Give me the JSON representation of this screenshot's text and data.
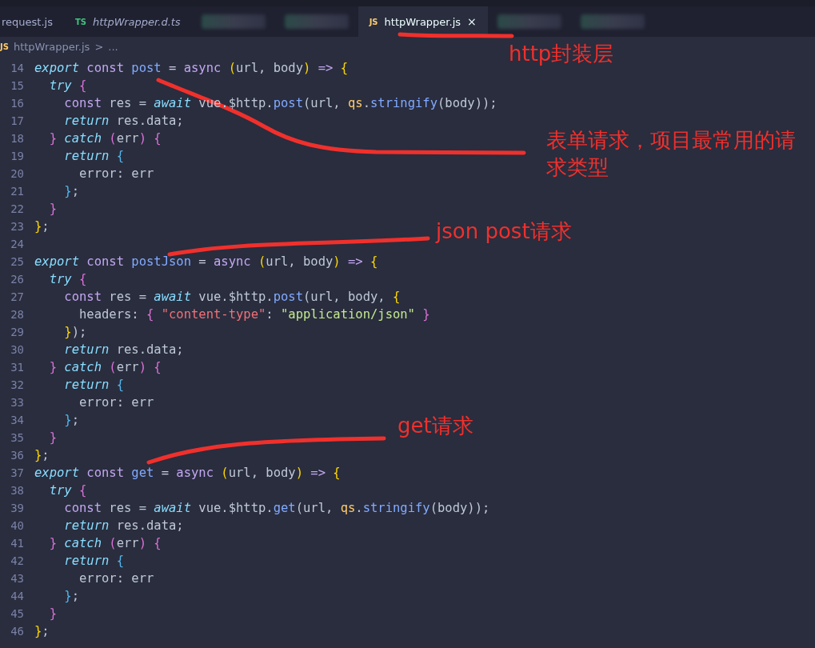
{
  "tabs": [
    {
      "kind": "file",
      "label": "request.js",
      "selected": false,
      "italic": false
    },
    {
      "kind": "file",
      "badge": "TS",
      "label": "httpWrapper.d.ts",
      "selected": false,
      "italic": true
    },
    {
      "kind": "blurred"
    },
    {
      "kind": "blurred"
    },
    {
      "kind": "file",
      "badge": "JS",
      "label": "httpWrapper.js",
      "selected": true,
      "italic": false,
      "close": "×"
    },
    {
      "kind": "blurred"
    },
    {
      "kind": "blurred"
    }
  ],
  "breadcrumb": {
    "badge": "JS",
    "file": "httpWrapper.js",
    "separator": ">",
    "rest": "..."
  },
  "lines": [
    {
      "number": "14",
      "tokens": [
        {
          "text": "export",
          "kind": "kw"
        },
        {
          "text": " const",
          "kind": "store"
        },
        {
          "text": " post",
          "kind": "fn"
        },
        {
          "text": " = ",
          "kind": "op"
        },
        {
          "text": "async",
          "kind": "store"
        },
        {
          "text": " (",
          "kind": "p1"
        },
        {
          "text": "url, body",
          "kind": "plain"
        },
        {
          "text": ")",
          "kind": "p1"
        },
        {
          "text": " =>",
          "kind": "store"
        },
        {
          "text": " {",
          "kind": "p1"
        }
      ]
    },
    {
      "number": "15",
      "tokens": [
        {
          "text": "  try",
          "kind": "kw"
        },
        {
          "text": " {",
          "kind": "p2"
        }
      ]
    },
    {
      "number": "16",
      "tokens": [
        {
          "text": "    const",
          "kind": "store"
        },
        {
          "text": " res = ",
          "kind": "plain"
        },
        {
          "text": "await",
          "kind": "kw"
        },
        {
          "text": " vue.$http.",
          "kind": "plain"
        },
        {
          "text": "post",
          "kind": "fn"
        },
        {
          "text": "(url, ",
          "kind": "plain"
        },
        {
          "text": "qs",
          "kind": "obj"
        },
        {
          "text": ".",
          "kind": "plain"
        },
        {
          "text": "stringify",
          "kind": "fn"
        },
        {
          "text": "(body));",
          "kind": "plain"
        }
      ]
    },
    {
      "number": "17",
      "tokens": [
        {
          "text": "    return",
          "kind": "kw"
        },
        {
          "text": " res.data;",
          "kind": "plain"
        }
      ]
    },
    {
      "number": "18",
      "tokens": [
        {
          "text": "  }",
          "kind": "p2"
        },
        {
          "text": " catch",
          "kind": "kw"
        },
        {
          "text": " (",
          "kind": "p2"
        },
        {
          "text": "err",
          "kind": "plain"
        },
        {
          "text": ")",
          "kind": "p2"
        },
        {
          "text": " {",
          "kind": "p2"
        }
      ]
    },
    {
      "number": "19",
      "tokens": [
        {
          "text": "    return",
          "kind": "kw"
        },
        {
          "text": " {",
          "kind": "p3"
        }
      ]
    },
    {
      "number": "20",
      "tokens": [
        {
          "text": "      error: err",
          "kind": "plain"
        }
      ]
    },
    {
      "number": "21",
      "tokens": [
        {
          "text": "    }",
          "kind": "p3"
        },
        {
          "text": ";",
          "kind": "plain"
        }
      ]
    },
    {
      "number": "22",
      "tokens": [
        {
          "text": "  }",
          "kind": "p2"
        }
      ]
    },
    {
      "number": "23",
      "tokens": [
        {
          "text": "}",
          "kind": "p1"
        },
        {
          "text": ";",
          "kind": "plain"
        }
      ]
    },
    {
      "number": "24"
    },
    {
      "number": "25",
      "tokens": [
        {
          "text": "export",
          "kind": "kw"
        },
        {
          "text": " const",
          "kind": "store"
        },
        {
          "text": " postJson",
          "kind": "fn"
        },
        {
          "text": " = ",
          "kind": "op"
        },
        {
          "text": "async",
          "kind": "store"
        },
        {
          "text": " (",
          "kind": "p1"
        },
        {
          "text": "url, body",
          "kind": "plain"
        },
        {
          "text": ")",
          "kind": "p1"
        },
        {
          "text": " =>",
          "kind": "store"
        },
        {
          "text": " {",
          "kind": "p1"
        }
      ]
    },
    {
      "number": "26",
      "tokens": [
        {
          "text": "  try",
          "kind": "kw"
        },
        {
          "text": " {",
          "kind": "p2"
        }
      ]
    },
    {
      "number": "27",
      "tokens": [
        {
          "text": "    const",
          "kind": "store"
        },
        {
          "text": " res = ",
          "kind": "plain"
        },
        {
          "text": "await",
          "kind": "kw"
        },
        {
          "text": " vue.$http.",
          "kind": "plain"
        },
        {
          "text": "post",
          "kind": "fn"
        },
        {
          "text": "(url, body, ",
          "kind": "plain"
        },
        {
          "text": "{",
          "kind": "p1"
        }
      ]
    },
    {
      "number": "28",
      "tokens": [
        {
          "text": "      headers: ",
          "kind": "plain"
        },
        {
          "text": "{",
          "kind": "p2"
        },
        {
          "text": " \"content-type\"",
          "kind": "str1"
        },
        {
          "text": ": ",
          "kind": "plain"
        },
        {
          "text": "\"application/json\"",
          "kind": "str2"
        },
        {
          "text": " }",
          "kind": "p2"
        }
      ]
    },
    {
      "number": "29",
      "tokens": [
        {
          "text": "    }",
          "kind": "p1"
        },
        {
          "text": ");",
          "kind": "plain"
        }
      ]
    },
    {
      "number": "30",
      "tokens": [
        {
          "text": "    return",
          "kind": "kw"
        },
        {
          "text": " res.data;",
          "kind": "plain"
        }
      ]
    },
    {
      "number": "31",
      "tokens": [
        {
          "text": "  }",
          "kind": "p2"
        },
        {
          "text": " catch",
          "kind": "kw"
        },
        {
          "text": " (",
          "kind": "p2"
        },
        {
          "text": "err",
          "kind": "plain"
        },
        {
          "text": ")",
          "kind": "p2"
        },
        {
          "text": " {",
          "kind": "p2"
        }
      ]
    },
    {
      "number": "32",
      "tokens": [
        {
          "text": "    return",
          "kind": "kw"
        },
        {
          "text": " {",
          "kind": "p3"
        }
      ]
    },
    {
      "number": "33",
      "tokens": [
        {
          "text": "      error: err",
          "kind": "plain"
        }
      ]
    },
    {
      "number": "34",
      "tokens": [
        {
          "text": "    }",
          "kind": "p3"
        },
        {
          "text": ";",
          "kind": "plain"
        }
      ]
    },
    {
      "number": "35",
      "tokens": [
        {
          "text": "  }",
          "kind": "p2"
        }
      ]
    },
    {
      "number": "36",
      "tokens": [
        {
          "text": "}",
          "kind": "p1"
        },
        {
          "text": ";",
          "kind": "plain"
        }
      ]
    },
    {
      "number": "37",
      "tokens": [
        {
          "text": "export",
          "kind": "kw"
        },
        {
          "text": " const",
          "kind": "store"
        },
        {
          "text": " get",
          "kind": "fn"
        },
        {
          "text": " = ",
          "kind": "op"
        },
        {
          "text": "async",
          "kind": "store"
        },
        {
          "text": " (",
          "kind": "p1"
        },
        {
          "text": "url, body",
          "kind": "plain"
        },
        {
          "text": ")",
          "kind": "p1"
        },
        {
          "text": " =>",
          "kind": "store"
        },
        {
          "text": " {",
          "kind": "p1"
        }
      ]
    },
    {
      "number": "38",
      "tokens": [
        {
          "text": "  try",
          "kind": "kw"
        },
        {
          "text": " {",
          "kind": "p2"
        }
      ]
    },
    {
      "number": "39",
      "tokens": [
        {
          "text": "    const",
          "kind": "store"
        },
        {
          "text": " res = ",
          "kind": "plain"
        },
        {
          "text": "await",
          "kind": "kw"
        },
        {
          "text": " vue.$http.",
          "kind": "plain"
        },
        {
          "text": "get",
          "kind": "fn"
        },
        {
          "text": "(url, ",
          "kind": "plain"
        },
        {
          "text": "qs",
          "kind": "obj"
        },
        {
          "text": ".",
          "kind": "plain"
        },
        {
          "text": "stringify",
          "kind": "fn"
        },
        {
          "text": "(body));",
          "kind": "plain"
        }
      ]
    },
    {
      "number": "40",
      "tokens": [
        {
          "text": "    return",
          "kind": "kw"
        },
        {
          "text": " res.data;",
          "kind": "plain"
        }
      ]
    },
    {
      "number": "41",
      "tokens": [
        {
          "text": "  }",
          "kind": "p2"
        },
        {
          "text": " catch",
          "kind": "kw"
        },
        {
          "text": " (",
          "kind": "p2"
        },
        {
          "text": "err",
          "kind": "plain"
        },
        {
          "text": ")",
          "kind": "p2"
        },
        {
          "text": " {",
          "kind": "p2"
        }
      ]
    },
    {
      "number": "42",
      "tokens": [
        {
          "text": "    return",
          "kind": "kw"
        },
        {
          "text": " {",
          "kind": "p3"
        }
      ]
    },
    {
      "number": "43",
      "tokens": [
        {
          "text": "      error: err",
          "kind": "plain"
        }
      ]
    },
    {
      "number": "44",
      "tokens": [
        {
          "text": "    }",
          "kind": "p3"
        },
        {
          "text": ";",
          "kind": "plain"
        }
      ]
    },
    {
      "number": "45",
      "tokens": [
        {
          "text": "  }",
          "kind": "p2"
        }
      ]
    },
    {
      "number": "46",
      "tokens": [
        {
          "text": "}",
          "kind": "p1"
        },
        {
          "text": ";",
          "kind": "plain"
        }
      ]
    }
  ],
  "annotations": [
    {
      "text": "http封装层"
    },
    {
      "text": "表单请求，项目最常用的请求类型"
    },
    {
      "text": "json post请求"
    },
    {
      "text": "get请求"
    }
  ]
}
